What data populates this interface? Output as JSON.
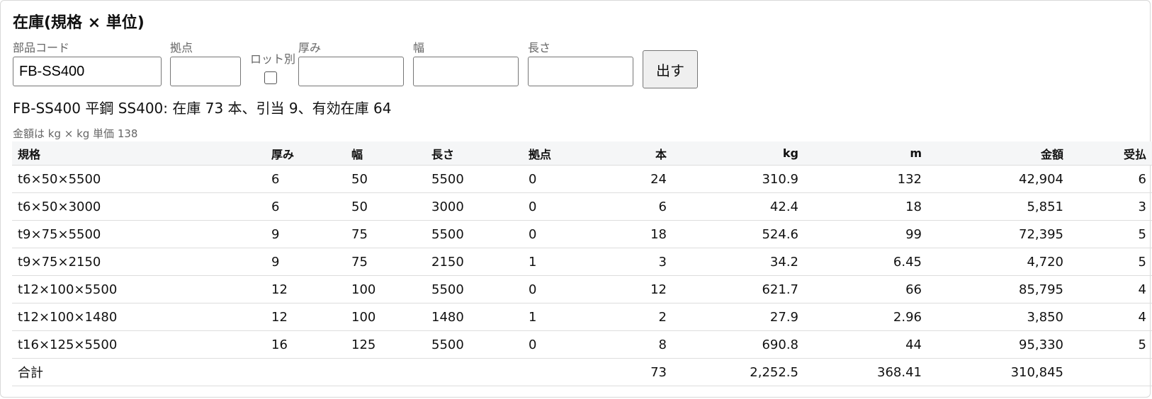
{
  "title": "在庫(規格 × 単位)",
  "form": {
    "part_code": {
      "label": "部品コード",
      "value": "FB-SS400"
    },
    "site": {
      "label": "拠点",
      "value": ""
    },
    "lot": {
      "label": "ロット別",
      "checked": false
    },
    "thickness": {
      "label": "厚み",
      "value": ""
    },
    "width": {
      "label": "幅",
      "value": ""
    },
    "length": {
      "label": "長さ",
      "value": ""
    },
    "submit_label": "出す"
  },
  "summary": "FB-SS400 平鋼 SS400: 在庫 73 本、引当 9、有効在庫 64",
  "note": "金額は kg × kg 単価 138",
  "table": {
    "headers": [
      "規格",
      "厚み",
      "幅",
      "長さ",
      "拠点",
      "本",
      "kg",
      "m",
      "金額",
      "受払"
    ],
    "rows": [
      [
        "t6×50×5500",
        "6",
        "50",
        "5500",
        "0",
        "24",
        "310.9",
        "132",
        "42,904",
        "6"
      ],
      [
        "t6×50×3000",
        "6",
        "50",
        "3000",
        "0",
        "6",
        "42.4",
        "18",
        "5,851",
        "3"
      ],
      [
        "t9×75×5500",
        "9",
        "75",
        "5500",
        "0",
        "18",
        "524.6",
        "99",
        "72,395",
        "5"
      ],
      [
        "t9×75×2150",
        "9",
        "75",
        "2150",
        "1",
        "3",
        "34.2",
        "6.45",
        "4,720",
        "5"
      ],
      [
        "t12×100×5500",
        "12",
        "100",
        "5500",
        "0",
        "12",
        "621.7",
        "66",
        "85,795",
        "4"
      ],
      [
        "t12×100×1480",
        "12",
        "100",
        "1480",
        "1",
        "2",
        "27.9",
        "2.96",
        "3,850",
        "4"
      ],
      [
        "t16×125×5500",
        "16",
        "125",
        "5500",
        "0",
        "8",
        "690.8",
        "44",
        "95,330",
        "5"
      ]
    ],
    "total": {
      "label": "合計",
      "count": "73",
      "kg": "2,252.5",
      "m": "368.41",
      "amount": "310,845"
    }
  }
}
